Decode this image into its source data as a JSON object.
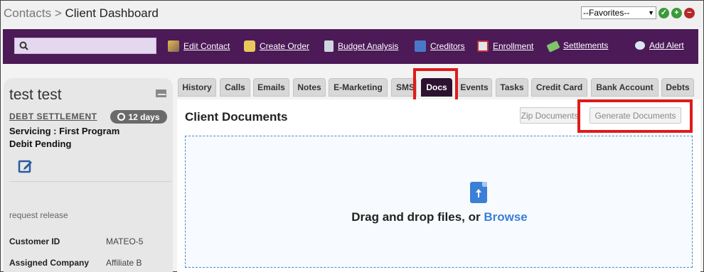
{
  "header": {
    "breadcrumb_parent": "Contacts",
    "breadcrumb_sep": ">",
    "breadcrumb_current": "Client Dashboard",
    "favorites_selected": "--Favorites--"
  },
  "colors": {
    "nav_bg": "#4b1a57",
    "active_tab": "#2c1230",
    "highlight": "#e01a1a",
    "link_blue": "#3b7fd6"
  },
  "nav": {
    "search_placeholder": "",
    "links": [
      {
        "label": "Edit Contact",
        "icon": "edit-contact-icon"
      },
      {
        "label": "Create Order",
        "icon": "create-order-icon"
      },
      {
        "label": "Budget Analysis",
        "icon": "calculator-icon"
      },
      {
        "label": "Creditors",
        "icon": "creditors-icon"
      },
      {
        "label": "Enrollment",
        "icon": "enrollment-icon"
      },
      {
        "label": "Settlements",
        "icon": "money-icon"
      },
      {
        "label": "Add Alert",
        "icon": "chat-alert-icon"
      }
    ]
  },
  "client": {
    "name": "test test",
    "program_type": "DEBT SETTLEMENT",
    "days_badge": "12 days",
    "status_line1": "Servicing : First Program",
    "status_line2": "Debit Pending",
    "note": "request release",
    "fields": [
      {
        "label": "Customer ID",
        "value": "MATEO-5"
      },
      {
        "label": "Assigned Company",
        "value": "Affiliate B"
      }
    ]
  },
  "tabs": [
    {
      "label": "History",
      "active": false
    },
    {
      "label": "Calls",
      "active": false
    },
    {
      "label": "Emails",
      "active": false
    },
    {
      "label": "Notes",
      "active": false
    },
    {
      "label": "E-Marketing",
      "active": false
    },
    {
      "label": "SMS",
      "active": false
    },
    {
      "label": "Docs",
      "active": true
    },
    {
      "label": "Events",
      "active": false
    },
    {
      "label": "Tasks",
      "active": false
    },
    {
      "label": "Credit Card",
      "active": false
    },
    {
      "label": "Bank Account",
      "active": false
    },
    {
      "label": "Debts",
      "active": false
    }
  ],
  "documents": {
    "title": "Client Documents",
    "zip_button": "Zip Documents",
    "generate_button": "Generate Documents",
    "drop_text": "Drag and drop files, or",
    "browse_text": "Browse"
  }
}
